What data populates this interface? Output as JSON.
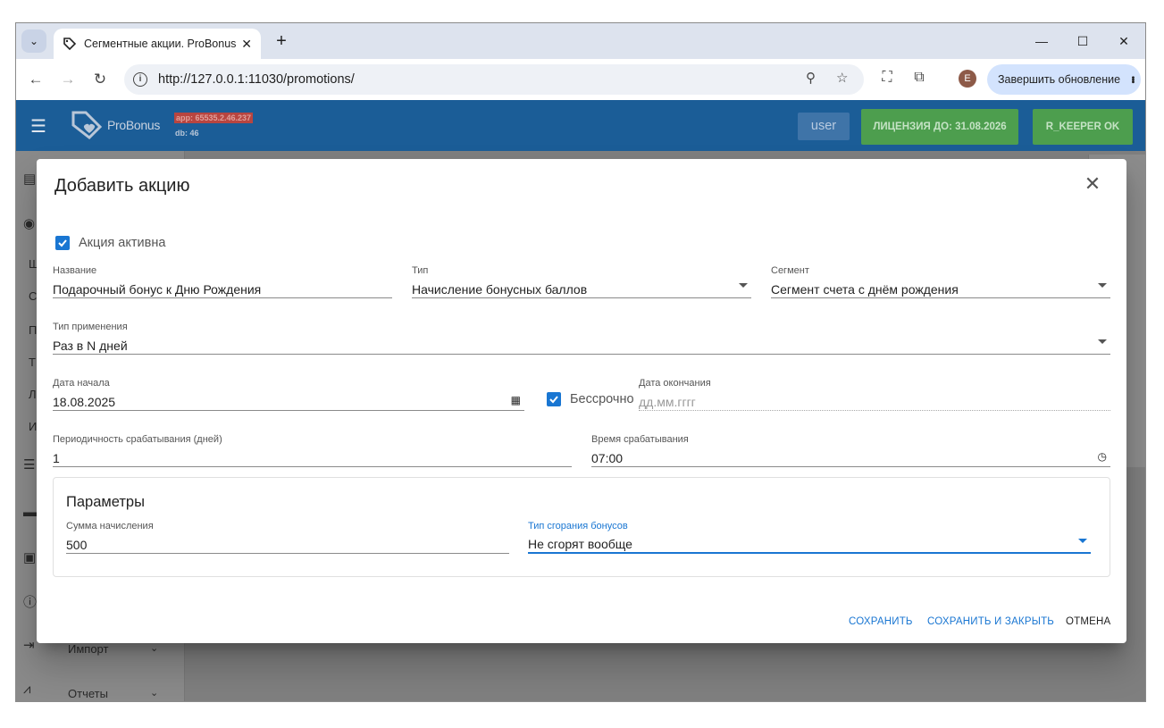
{
  "browser": {
    "tab_title": "Сегментные акции. ProBonus",
    "new_tab": "+",
    "url": "http://127.0.0.1:11030/promotions/",
    "profile_initial": "E",
    "update_label": "Завершить обновление",
    "window_controls": {
      "minimize": "—",
      "maximize": "☐",
      "close": "✕"
    }
  },
  "app": {
    "logo_text": "ProBonus",
    "app_version": "app: 65535.2.46.237",
    "db_version": "db: 46",
    "user_button": "user",
    "license_button": "ЛИЦЕНЗИЯ ДО: 31.08.2026",
    "rkeeper_button": "R_KEEPER OK",
    "sidebar_letters": [
      "Ш",
      "С",
      "П",
      "Т",
      "Л",
      "И"
    ],
    "sidebar_import": "Импорт",
    "sidebar_reports": "Отчеты"
  },
  "dialog": {
    "title": "Добавить акцию",
    "active_checkbox": {
      "label": "Акция активна",
      "checked": true
    },
    "name": {
      "label": "Название",
      "value": "Подарочный бонус к Дню Рождения"
    },
    "type": {
      "label": "Тип",
      "value": "Начисление бонусных баллов"
    },
    "segment": {
      "label": "Сегмент",
      "value": "Сегмент счета с днём рождения"
    },
    "apply_type": {
      "label": "Тип применения",
      "value": "Раз в N дней"
    },
    "start_date": {
      "label": "Дата начала",
      "value": "18.08.2025"
    },
    "indefinite": {
      "label": "Бессрочно",
      "checked": true
    },
    "end_date": {
      "label": "Дата окончания",
      "placeholder": "дд.мм.гггг"
    },
    "period": {
      "label": "Периодичность срабатывания (дней)",
      "value": "1"
    },
    "trigger_time": {
      "label": "Время срабатывания",
      "value": "07:00"
    },
    "params": {
      "title": "Параметры",
      "amount": {
        "label": "Сумма начисления",
        "value": "500"
      },
      "burn_type": {
        "label": "Тип сгорания бонусов",
        "value": "Не сгорят вообще"
      }
    },
    "buttons": {
      "save": "СОХРАНИТЬ",
      "save_close": "СОХРАНИТЬ И ЗАКРЫТЬ",
      "cancel": "ОТМЕНА"
    }
  },
  "colors": {
    "primary": "#1976d2",
    "appbar": "#1b5d97",
    "license_green": "#4d9e4e"
  }
}
